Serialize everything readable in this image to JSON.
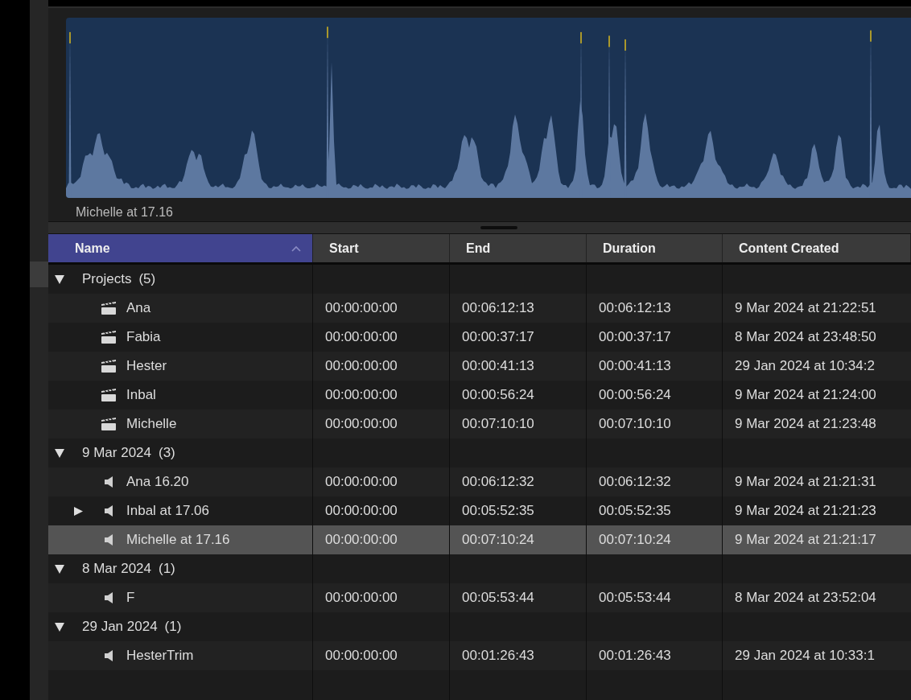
{
  "viewer": {
    "clip_title": "Michelle at 17.16"
  },
  "table": {
    "columns": [
      {
        "label": "Name",
        "sorted": true
      },
      {
        "label": "Start",
        "sorted": false
      },
      {
        "label": "End",
        "sorted": false
      },
      {
        "label": "Duration",
        "sorted": false
      },
      {
        "label": "Content Created",
        "sorted": false
      }
    ],
    "groups": [
      {
        "label": "Projects",
        "count": "(5)",
        "expanded": true,
        "children": [
          {
            "kind": "project",
            "collapsed": false,
            "selected": false,
            "cells": [
              "Ana",
              "00:00:00:00",
              "00:06:12:13",
              "00:06:12:13",
              "9 Mar 2024 at 21:22:51"
            ]
          },
          {
            "kind": "project",
            "collapsed": false,
            "selected": false,
            "cells": [
              "Fabia",
              "00:00:00:00",
              "00:00:37:17",
              "00:00:37:17",
              "8 Mar 2024 at 23:48:50"
            ]
          },
          {
            "kind": "project",
            "collapsed": false,
            "selected": false,
            "cells": [
              "Hester",
              "00:00:00:00",
              "00:00:41:13",
              "00:00:41:13",
              "29 Jan 2024 at 10:34:2"
            ]
          },
          {
            "kind": "project",
            "collapsed": false,
            "selected": false,
            "cells": [
              "Inbal",
              "00:00:00:00",
              "00:00:56:24",
              "00:00:56:24",
              "9 Mar 2024 at 21:24:00"
            ]
          },
          {
            "kind": "project",
            "collapsed": false,
            "selected": false,
            "cells": [
              "Michelle",
              "00:00:00:00",
              "00:07:10:10",
              "00:07:10:10",
              "9 Mar 2024 at 21:23:48"
            ]
          }
        ]
      },
      {
        "label": "9 Mar 2024",
        "count": "(3)",
        "expanded": true,
        "children": [
          {
            "kind": "audio",
            "collapsed": false,
            "selected": false,
            "cells": [
              "Ana 16.20",
              "00:00:00:00",
              "00:06:12:32",
              "00:06:12:32",
              "9 Mar 2024 at 21:21:31"
            ]
          },
          {
            "kind": "audio",
            "collapsed": true,
            "selected": false,
            "cells": [
              "Inbal at 17.06",
              "00:00:00:00",
              "00:05:52:35",
              "00:05:52:35",
              "9 Mar 2024 at 21:21:23"
            ]
          },
          {
            "kind": "audio",
            "collapsed": false,
            "selected": true,
            "cells": [
              "Michelle at 17.16",
              "00:00:00:00",
              "00:07:10:24",
              "00:07:10:24",
              "9 Mar 2024 at 21:21:17"
            ]
          }
        ]
      },
      {
        "label": "8 Mar 2024",
        "count": "(1)",
        "expanded": true,
        "children": [
          {
            "kind": "audio",
            "collapsed": false,
            "selected": false,
            "cells": [
              "F",
              "00:00:00:00",
              "00:05:53:44",
              "00:05:53:44",
              "8 Mar 2024 at 23:52:04"
            ]
          }
        ]
      },
      {
        "label": "29 Jan 2024",
        "count": "(1)",
        "expanded": true,
        "children": [
          {
            "kind": "audio",
            "collapsed": false,
            "selected": false,
            "cells": [
              "HesterTrim",
              "00:00:00:00",
              "00:01:26:43",
              "00:01:26:43",
              "29 Jan 2024 at 10:33:1"
            ]
          }
        ]
      }
    ]
  }
}
